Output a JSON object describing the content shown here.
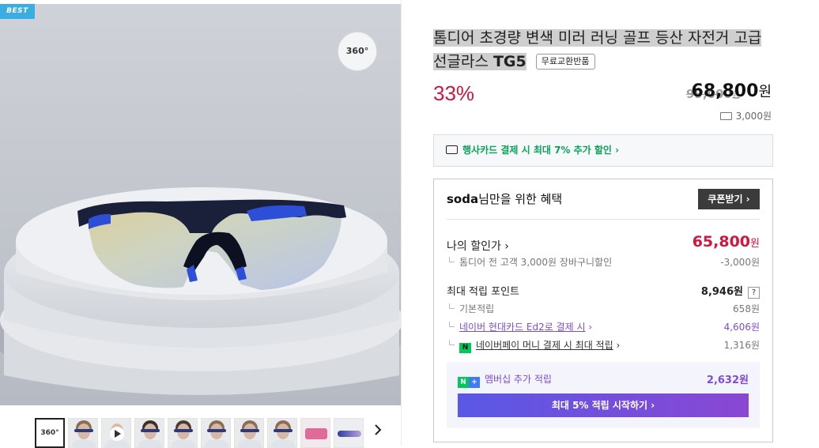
{
  "gallery": {
    "badge": "BEST",
    "btn360": "360°",
    "thumb360": "360°",
    "next_icon": "chevron-right"
  },
  "product": {
    "title_main": "톰디어 초경량 변색 미러 러닝 골프 등산 자전거 고급",
    "title_line2": "선글라스",
    "title_model": "TG5",
    "badge": "무료교환반품",
    "discount_rate": "33%",
    "original_price": "99,000",
    "original_unit": "원",
    "sale_price": "68,800",
    "sale_unit": "원",
    "shipping": "3,000원",
    "card_promo": "행사카드 결제 시 최대 7% 추가 할인 ›"
  },
  "benefit": {
    "user": "soda",
    "title_suffix": "님만을 위한 혜택",
    "coupon_button": "쿠폰받기 ›",
    "my_price_label": "나의 할인가 ›",
    "my_price": "65,800",
    "my_price_unit": "원",
    "cart_discount_label": "톰디어 전 고객 3,000원 장바구니할인",
    "cart_discount_value": "-3,000원",
    "points_label": "최대 적립 포인트",
    "points_value": "8,946원",
    "help": "?",
    "basic_label": "기본적립",
    "basic_value": "658원",
    "hyundai_label": "네이버 현대카드 Ed2로 결제 시",
    "hyundai_arrow": "›",
    "hyundai_value": "4,606원",
    "npay_icon": "N",
    "npay_label": "네이버페이 머니 결제 시 최대 적립",
    "npay_arrow": "›",
    "npay_value": "1,316원",
    "member_icon_n": "N",
    "member_icon_plus": "+",
    "member_label": "멤버십 추가 적립",
    "member_value": "2,632원",
    "start_button": "최대 5% 적립 시작하기 ›"
  },
  "colors": {
    "accent_red": "#d4163e",
    "accent_green": "#0aa35c",
    "accent_purple": "#7c4dd6"
  }
}
